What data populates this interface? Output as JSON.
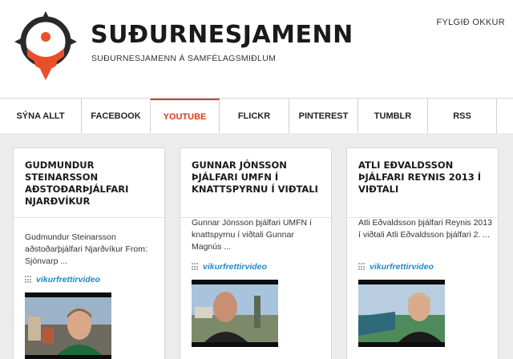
{
  "header": {
    "title": "SUÐURNESJAMENN",
    "subtitle": "SUÐURNESJAMENN Á SAMFÉLAGSMIÐLUM",
    "follow_label": "FYLGIÐ OKKUR"
  },
  "nav": {
    "tabs": [
      {
        "label": "SÝNA ALLT"
      },
      {
        "label": "FACEBOOK"
      },
      {
        "label": "YOUTUBE"
      },
      {
        "label": "FLICKR"
      },
      {
        "label": "PINTEREST"
      },
      {
        "label": "TUMBLR"
      },
      {
        "label": "RSS"
      }
    ],
    "active": "YOUTUBE"
  },
  "cards": [
    {
      "title": "GUDMUNDUR STEINARSSON AÐSTOÐARÞJÁLFARI NJARÐVÍKUR",
      "text": "Gudmundur Steinarsson aðstoðarþjálfari Njarðvíkur From: Sjónvarp ...",
      "source": "vikurfrettirvideo"
    },
    {
      "title": "GUNNAR JÓNSSON ÞJÁLFARI UMFN Í KNATTSPYRNU Í VIÐTALI",
      "text": "Gunnar Jónsson þjálfari UMFN í knattspyrnu í viðtali Gunnar Magnús ...",
      "source": "vikurfrettirvideo"
    },
    {
      "title": "ATLI EÐVALDSSON ÞJÁLFARI REYNIS 2013 Í VIÐTALI",
      "text": "Atli Eðvaldsson þjálfari Reynis 2013 í viðtali Atli Eðvaldsson þjálfari 2. ...",
      "source": "vikurfrettirvideo"
    }
  ],
  "colors": {
    "accent": "#d93a1f",
    "link": "#1f8ac9",
    "logo_dark": "#2a2a2a",
    "background": "#ececec"
  }
}
